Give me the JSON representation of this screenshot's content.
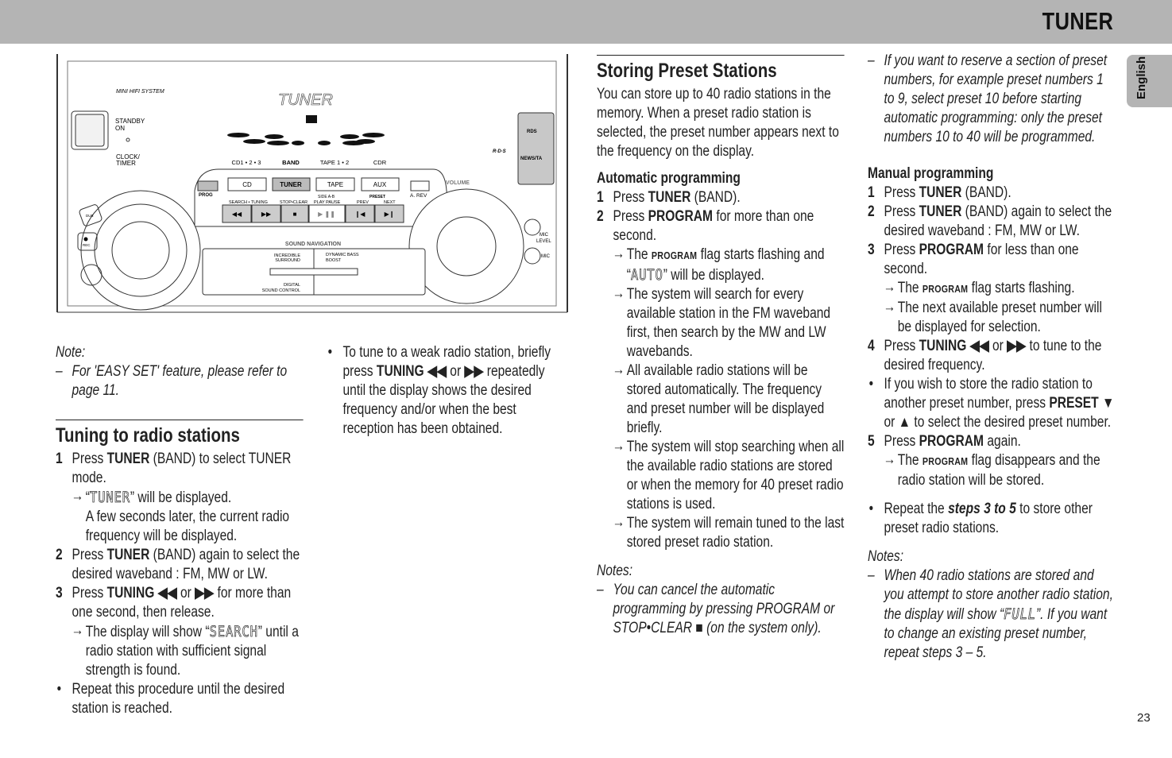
{
  "header": {
    "title": "TUNER"
  },
  "language_tab": "English",
  "page_number": "23",
  "device_illustration": {
    "brand_line": "MINI HIFI SYSTEM",
    "display_text": "TUNER",
    "standby": "STANDBY",
    "on": "ON",
    "clock": "CLOCK/",
    "timer": "TIMER",
    "rds": "RDS",
    "news_ta": "NEWS/TA",
    "rds_logo": "R·D·S",
    "sources": [
      "CD1 • 2 • 3",
      "BAND",
      "TAPE 1 • 2",
      "CDR"
    ],
    "source_buttons": [
      "CD",
      "TUNER",
      "TAPE",
      "AUX"
    ],
    "prog": "PROG",
    "a_rev": "A. REV",
    "volume": "VOLUME",
    "search_tuning": "SEARCH • TUNING",
    "stop_clear": "STOP•CLEAR",
    "side_ab": "SIDE A-B",
    "play_pause": "PLAY   PAUSE",
    "preset": "PRESET",
    "prev": "PREV",
    "next": "NEXT",
    "transport_glyphs": [
      "◀◀",
      "▶▶",
      "■",
      "▶  ❚❚",
      "❙◀",
      "▶❙"
    ],
    "sound_navigation": "SOUND NAVIGATION",
    "incredible_surround": [
      "INCREDIBLE",
      "SURROUND"
    ],
    "dynamic_bass_boost": [
      "DYNAMIC BASS",
      "BOOST"
    ],
    "digital_sound_control": [
      "DIGITAL",
      "SOUND CONTROL"
    ],
    "mic_level": [
      "MIC",
      "LEVEL"
    ],
    "mic": "MIC",
    "dub": "DUB",
    "rec": "REC"
  },
  "columns": [
    {
      "blocks": [
        {
          "type": "notelabel",
          "segs": [
            {
              "t": "Note:"
            }
          ]
        },
        {
          "type": "dash",
          "segs": [
            {
              "t": "For 'EASY SET' feature, please refer to page 11."
            }
          ]
        },
        {
          "type": "spacer"
        },
        {
          "type": "spacer"
        },
        {
          "type": "heading",
          "segs": [
            {
              "t": "Tuning to radio stations"
            }
          ]
        },
        {
          "type": "step",
          "num": "1",
          "segs": [
            {
              "t": "Press "
            },
            {
              "b": "TUNER"
            },
            {
              "t": " (BAND) to select TUNER mode."
            }
          ]
        },
        {
          "type": "arrow",
          "segs": [
            {
              "t": "“"
            },
            {
              "lcd": "TUNER"
            },
            {
              "t": "” will be displayed."
            }
          ]
        },
        {
          "type": "indent",
          "segs": [
            {
              "t": "A few seconds later, the current radio frequency will be displayed."
            }
          ]
        },
        {
          "type": "step",
          "num": "2",
          "segs": [
            {
              "t": "Press "
            },
            {
              "b": "TUNER"
            },
            {
              "t": " (BAND) again to select the desired waveband : FM, MW or LW."
            }
          ]
        },
        {
          "type": "step",
          "num": "3",
          "segs": [
            {
              "t": "Press "
            },
            {
              "b": "TUNING ◀◀"
            },
            {
              "t": " or "
            },
            {
              "b": "▶▶"
            },
            {
              "t": " for more than one second, then release."
            }
          ]
        },
        {
          "type": "arrow",
          "segs": [
            {
              "t": "The display will show “"
            },
            {
              "lcd": "SEARCH"
            },
            {
              "t": "” until a radio station with sufficient signal strength is found."
            }
          ]
        },
        {
          "type": "bullet",
          "segs": [
            {
              "t": "Repeat this procedure until the desired station is reached."
            }
          ]
        }
      ]
    },
    {
      "blocks": [
        {
          "type": "bullet",
          "segs": [
            {
              "t": "To tune to a weak radio station, briefly press "
            },
            {
              "b": "TUNING ◀◀"
            },
            {
              "t": " or "
            },
            {
              "b": "▶▶"
            },
            {
              "t": " repeatedly until the display shows the desired frequency and/or when the best reception has been obtained."
            }
          ]
        }
      ]
    },
    {
      "blocks": [
        {
          "type": "heading",
          "segs": [
            {
              "t": "Storing Preset Stations"
            }
          ]
        },
        {
          "type": "para",
          "segs": [
            {
              "t": "You can store up to 40 radio stations in the memory. When a preset radio station is selected, the preset number appears next to the frequency on the display."
            }
          ]
        },
        {
          "type": "subheading",
          "segs": [
            {
              "t": "Automatic programming"
            }
          ]
        },
        {
          "type": "step",
          "num": "1",
          "segs": [
            {
              "t": "Press "
            },
            {
              "b": "TUNER"
            },
            {
              "t": " (BAND)."
            }
          ]
        },
        {
          "type": "step",
          "num": "2",
          "segs": [
            {
              "t": "Press "
            },
            {
              "b": "PROGRAM"
            },
            {
              "t": " for more than one second."
            }
          ]
        },
        {
          "type": "arrow",
          "segs": [
            {
              "t": "The "
            },
            {
              "sc": "PROGRAM"
            },
            {
              "t": " flag starts flashing and “"
            },
            {
              "lcd": "AUTO"
            },
            {
              "t": "” will be displayed."
            }
          ]
        },
        {
          "type": "arrow",
          "segs": [
            {
              "t": "The system will search for every available station in the FM waveband first, then search by the MW and LW wavebands."
            }
          ]
        },
        {
          "type": "arrow",
          "segs": [
            {
              "t": "All available radio stations will be stored automatically. The frequency and preset number will be displayed briefly."
            }
          ]
        },
        {
          "type": "arrow",
          "segs": [
            {
              "t": "The system will stop searching when all the available radio stations are stored or when the memory for 40 preset radio stations is used."
            }
          ]
        },
        {
          "type": "arrow",
          "segs": [
            {
              "t": "The system will remain tuned to the last stored preset radio station."
            }
          ]
        },
        {
          "type": "spacer"
        },
        {
          "type": "notelabel",
          "segs": [
            {
              "t": "Notes:"
            }
          ]
        },
        {
          "type": "dash",
          "segs": [
            {
              "t": "You can cancel the automatic programming by pressing PROGRAM or STOP•CLEAR  ■  (on the system only)."
            }
          ]
        }
      ]
    },
    {
      "blocks": [
        {
          "type": "dash",
          "segs": [
            {
              "t": "If you want to reserve a section of preset numbers, for example preset numbers 1 to 9, select preset 10 before starting automatic programming: only the preset numbers 10 to 40 will be programmed."
            }
          ]
        },
        {
          "type": "spacer"
        },
        {
          "type": "subheading",
          "segs": [
            {
              "t": "Manual programming"
            }
          ]
        },
        {
          "type": "step",
          "num": "1",
          "segs": [
            {
              "t": "Press "
            },
            {
              "b": "TUNER"
            },
            {
              "t": " (BAND)."
            }
          ]
        },
        {
          "type": "step",
          "num": "2",
          "segs": [
            {
              "t": "Press "
            },
            {
              "b": "TUNER"
            },
            {
              "t": " (BAND) again to select the desired waveband : FM, MW or LW."
            }
          ]
        },
        {
          "type": "step",
          "num": "3",
          "segs": [
            {
              "t": "Press "
            },
            {
              "b": "PROGRAM"
            },
            {
              "t": " for less than one second."
            }
          ]
        },
        {
          "type": "arrow",
          "segs": [
            {
              "t": "The "
            },
            {
              "sc": "PROGRAM"
            },
            {
              "t": " flag starts flashing."
            }
          ]
        },
        {
          "type": "arrow",
          "segs": [
            {
              "t": "The next available preset number will be displayed for selection."
            }
          ]
        },
        {
          "type": "step",
          "num": "4",
          "segs": [
            {
              "t": "Press "
            },
            {
              "b": "TUNING ◀◀"
            },
            {
              "t": " or "
            },
            {
              "b": "▶▶"
            },
            {
              "t": " to tune to the desired frequency."
            }
          ]
        },
        {
          "type": "bullet",
          "segs": [
            {
              "t": "If you wish to store the radio station to another preset number, press "
            },
            {
              "b": "PRESET"
            },
            {
              "t": " ▼ or ▲ to select the desired preset number."
            }
          ]
        },
        {
          "type": "step",
          "num": "5",
          "segs": [
            {
              "t": "Press "
            },
            {
              "b": "PROGRAM"
            },
            {
              "t": " again."
            }
          ]
        },
        {
          "type": "arrow",
          "segs": [
            {
              "t": "The "
            },
            {
              "sc": "PROGRAM"
            },
            {
              "t": " flag disappears and the radio station will be stored."
            }
          ]
        },
        {
          "type": "spacer"
        },
        {
          "type": "bullet",
          "segs": [
            {
              "t": "Repeat the "
            },
            {
              "bi": "steps 3 to 5"
            },
            {
              "t": " to store other preset radio stations."
            }
          ]
        },
        {
          "type": "spacer"
        },
        {
          "type": "notelabel",
          "segs": [
            {
              "t": "Notes:"
            }
          ]
        },
        {
          "type": "dash",
          "segs": [
            {
              "t": "When 40 radio stations are stored and you attempt to store another radio station, the display will show “"
            },
            {
              "lcd": "FULL"
            },
            {
              "t": "”. If you want to change an existing preset number, repeat steps 3 – 5."
            }
          ]
        }
      ]
    }
  ]
}
